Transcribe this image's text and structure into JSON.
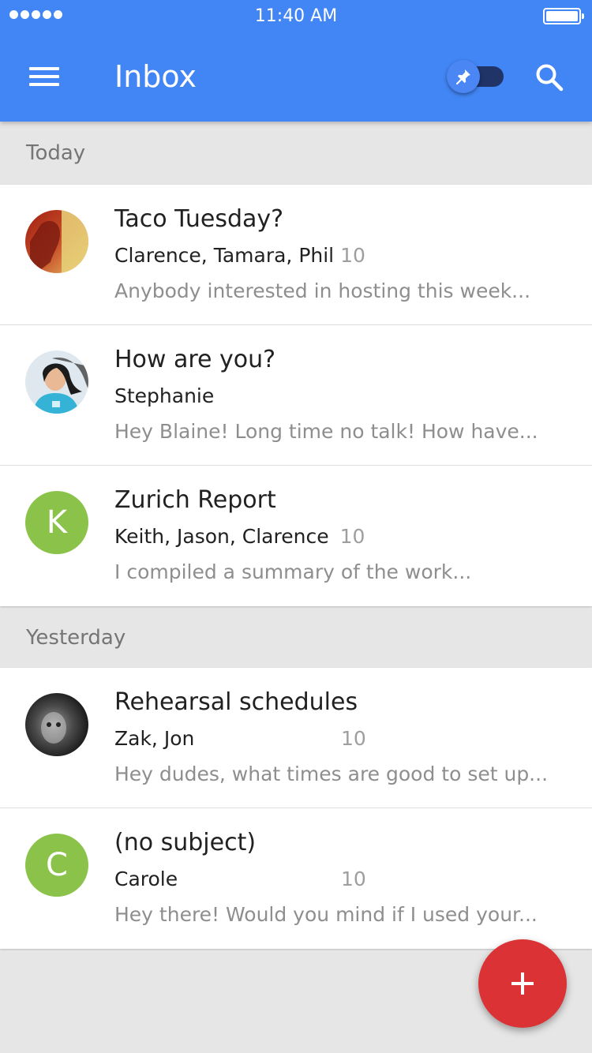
{
  "status_bar": {
    "time": "11:40 AM",
    "signal_bars": 5
  },
  "header": {
    "title": "Inbox",
    "menu_icon": "hamburger-menu-icon",
    "pin_icon": "pin-icon",
    "search_icon": "search-icon",
    "pinned_toggle_on": true,
    "color": "#4285f4"
  },
  "sections": [
    {
      "label": "Today",
      "threads": [
        {
          "subject": "Taco Tuesday?",
          "senders": "Clarence, Tamara, Phil",
          "count": "10",
          "snippet": "Anybody interested in hosting this week...",
          "avatar": {
            "type": "photo",
            "description": "profile-photo"
          }
        },
        {
          "subject": "How are you?",
          "senders": "Stephanie",
          "count": "",
          "snippet": "Hey Blaine!  Long time no talk!  How have...",
          "avatar": {
            "type": "photo",
            "description": "profile-photo"
          }
        },
        {
          "subject": "Zurich Report",
          "senders": "Keith, Jason, Clarence",
          "count": "10",
          "snippet": "I compiled a summary of the work...",
          "avatar": {
            "type": "letter",
            "letter": "K",
            "color": "#8bc34a"
          }
        }
      ]
    },
    {
      "label": "Yesterday",
      "threads": [
        {
          "subject": "Rehearsal schedules",
          "senders": "Zak, Jon",
          "count": "10",
          "snippet": "Hey dudes, what times are good to set up...",
          "avatar": {
            "type": "photo",
            "description": "profile-photo"
          }
        },
        {
          "subject": "(no subject)",
          "senders": "Carole",
          "count": "10",
          "snippet": "Hey there!  Would you mind if I used your...",
          "avatar": {
            "type": "letter",
            "letter": "C",
            "color": "#8bc34a"
          }
        }
      ]
    }
  ],
  "fab": {
    "icon": "plus-icon",
    "color": "#db3236"
  }
}
